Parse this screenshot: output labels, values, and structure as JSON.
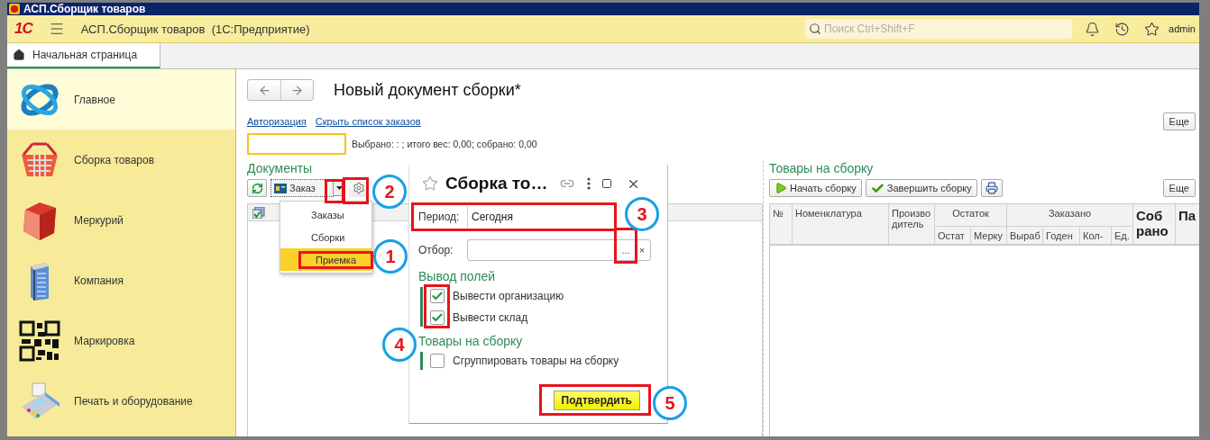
{
  "window": {
    "title": "АСП.Сборщик товаров"
  },
  "app_bar": {
    "logo": "1С",
    "title": "АСП.Сборщик товаров  (1С:Предприятие)",
    "search": {
      "placeholder": "Поиск Ctrl+Shift+F"
    },
    "user": "admin"
  },
  "tabs": [
    {
      "label": "Начальная страница",
      "selected": true
    }
  ],
  "sidebar": {
    "items": [
      {
        "label": "Главное",
        "kind": "orbit",
        "selected": true
      },
      {
        "label": "Сборка товаров",
        "kind": "basket",
        "selected": false
      },
      {
        "label": "Меркурий",
        "kind": "cube",
        "selected": false
      },
      {
        "label": "Компания",
        "kind": "building",
        "selected": false
      },
      {
        "label": "Маркировка",
        "kind": "qr",
        "selected": false
      },
      {
        "label": "Печать и оборудование",
        "kind": "terminal",
        "selected": false
      }
    ]
  },
  "document": {
    "title": "Новый документ сборки*",
    "links": [
      "Авторизация",
      "Скрыть список заказов"
    ],
    "more_button": "Еще",
    "summary": "Выбрано: : ; итого вес: 0,00; собрано: 0,00"
  },
  "documents_panel": {
    "title": "Документы",
    "view_select": {
      "value": "Заказ"
    },
    "menu": [
      {
        "label": "Заказы",
        "selected": false,
        "highlighted": false
      },
      {
        "label": "Сборки",
        "selected": false,
        "highlighted": false
      },
      {
        "label": "Приемка",
        "selected": true,
        "highlighted": true
      }
    ]
  },
  "dialog": {
    "title": "Сборка то…",
    "period": {
      "label": "Период:",
      "value": "Сегодня"
    },
    "filter": {
      "label": "Отбор:",
      "select_button": "...",
      "clear_button": "×"
    },
    "groups": [
      {
        "title": "Вывод полей",
        "options": [
          {
            "label": "Вывести организацию",
            "checked": true
          },
          {
            "label": "Вывести склад",
            "checked": true
          }
        ]
      },
      {
        "title": "Товары на сборку",
        "options": [
          {
            "label": "Сгруппировать товары на сборку",
            "checked": false
          }
        ]
      }
    ],
    "confirm_button": "Подтвердить"
  },
  "goods_panel": {
    "title": "Товары на сборку",
    "buttons": [
      {
        "label": "Начать сборку",
        "kind": "start"
      },
      {
        "label": "Завершить сборку",
        "kind": "finish"
      }
    ],
    "more_button": "Еще",
    "columns": [
      {
        "label": "№"
      },
      {
        "label": "Номенклатура"
      },
      {
        "label": "Производитель"
      },
      {
        "label": "Остаток",
        "children": [
          {
            "label": "Остат"
          },
          {
            "label": "Мерку"
          }
        ]
      },
      {
        "label": "Заказано",
        "children": [
          {
            "label": "Выраб"
          },
          {
            "label": "Годен"
          },
          {
            "label": "Кол-"
          },
          {
            "label": "Ед."
          }
        ]
      },
      {
        "label": "Собрано",
        "kind": "bold"
      },
      {
        "label": "Па",
        "kind": "bold"
      }
    ]
  },
  "annotations": [
    {
      "label": "2"
    },
    {
      "label": "3"
    },
    {
      "label": "1"
    },
    {
      "label": "4"
    },
    {
      "label": "5"
    }
  ]
}
